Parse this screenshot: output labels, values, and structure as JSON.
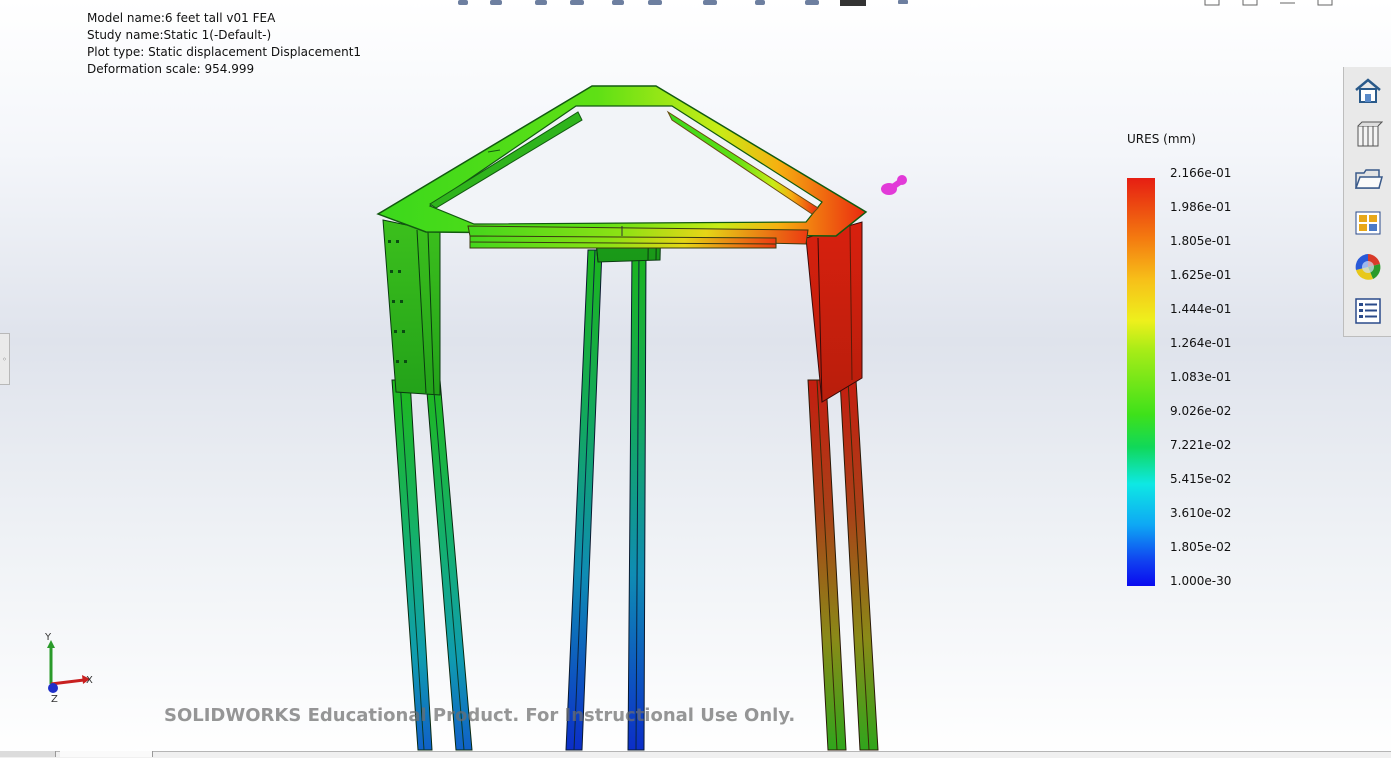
{
  "info": {
    "model_name": "Model name:6 feet tall v01 FEA",
    "study_name": "Study name:Static 1(-Default-)",
    "plot_type": "Plot type: Static displacement Displacement1",
    "deformation_scale": "Deformation scale: 954.999"
  },
  "legend": {
    "title": "URES (mm)",
    "ticks": [
      "2.166e-01",
      "1.986e-01",
      "1.805e-01",
      "1.625e-01",
      "1.444e-01",
      "1.264e-01",
      "1.083e-01",
      "9.026e-02",
      "7.221e-02",
      "5.415e-02",
      "3.610e-02",
      "1.805e-02",
      "1.000e-30"
    ],
    "colors": [
      "#e61e12",
      "#f47c10",
      "#eef01c",
      "#3ee11a",
      "#0ee8e4",
      "#0a0aef"
    ]
  },
  "triad": {
    "x": "X",
    "y": "Y",
    "z": "Z"
  },
  "watermark": "SOLIDWORKS Educational Product. For Instructional Use Only.",
  "task_pane": [
    "home-icon",
    "design-library-icon",
    "file-explorer-icon",
    "view-palette-icon",
    "appearances-icon",
    "custom-properties-icon"
  ],
  "colors": {
    "high": "#e61e12",
    "mid": "#3ee11a",
    "low": "#0a0aef",
    "probe": "#e23ad8"
  }
}
